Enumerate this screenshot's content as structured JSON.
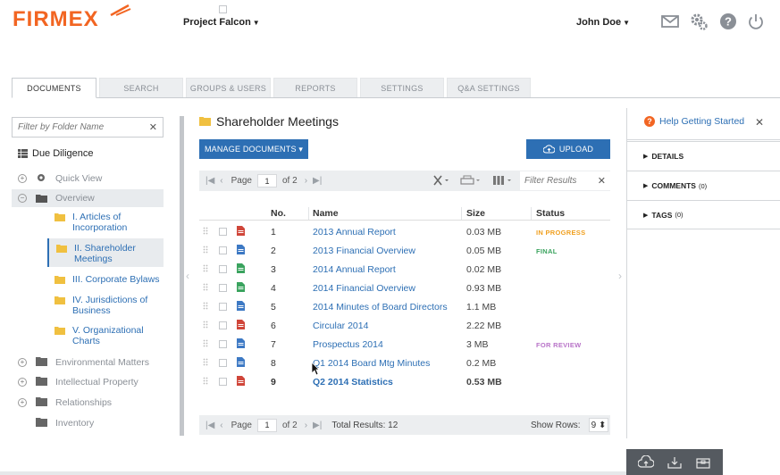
{
  "header": {
    "logo": "FIRMEX",
    "project": "Project Falcon",
    "user": "John Doe",
    "icons": [
      "mail-icon",
      "gears-icon",
      "help-icon",
      "power-icon"
    ]
  },
  "tabs": [
    {
      "label": "DOCUMENTS",
      "active": true
    },
    {
      "label": "SEARCH"
    },
    {
      "label": "GROUPS & USERS"
    },
    {
      "label": "REPORTS"
    },
    {
      "label": "SETTINGS"
    },
    {
      "label": "Q&A SETTINGS"
    }
  ],
  "tree": {
    "filter_placeholder": "Filter by Folder Name",
    "root": "Due Diligence",
    "quick_view": "Quick View",
    "overview": "Overview",
    "subfolders": [
      "I. Articles of Incorporation",
      "II. Shareholder Meetings",
      "III. Corporate Bylaws",
      "IV. Jurisdictions of Business",
      "V. Organizational Charts"
    ],
    "others": [
      "Environmental Matters",
      "Intellectual Property",
      "Relationships",
      "Inventory"
    ]
  },
  "center": {
    "folder_title": "Shareholder Meetings",
    "manage_btn": "MANAGE DOCUMENTS ▾",
    "upload_btn": "UPLOAD",
    "page_label": "Page",
    "page_num": "1",
    "of_pages": "of 2",
    "filter_placeholder": "Filter Results",
    "headers": {
      "no": "No.",
      "name": "Name",
      "size": "Size",
      "status": "Status"
    },
    "rows": [
      {
        "no": "1",
        "name": "2013 Annual Report",
        "size": "0.03 MB",
        "status": "IN PROGRESS",
        "file": "pdf"
      },
      {
        "no": "2",
        "name": "2013 Financial Overview",
        "size": "0.05 MB",
        "status": "FINAL",
        "file": "doc"
      },
      {
        "no": "3",
        "name": "2014 Annual Report",
        "size": "0.02 MB",
        "status": "",
        "file": "xls"
      },
      {
        "no": "4",
        "name": "2014 Financial Overview",
        "size": "0.93 MB",
        "status": "",
        "file": "xls"
      },
      {
        "no": "5",
        "name": "2014 Minutes of Board Directors",
        "size": "1.1 MB",
        "status": "",
        "file": "doc"
      },
      {
        "no": "6",
        "name": "Circular 2014",
        "size": "2.22 MB",
        "status": "",
        "file": "pdf"
      },
      {
        "no": "7",
        "name": "Prospectus 2014",
        "size": "3 MB",
        "status": "FOR REVIEW",
        "file": "doc"
      },
      {
        "no": "8",
        "name": "Q1 2014 Board Mtg Minutes",
        "size": "0.2 MB",
        "status": "",
        "file": "doc"
      },
      {
        "no": "9",
        "name": "Q2 2014 Statistics",
        "size": "0.53 MB",
        "status": "",
        "file": "pdf",
        "bold": true
      }
    ],
    "total_results": "Total Results: 12",
    "show_rows": "Show Rows:",
    "rows_value": "9 ⬍"
  },
  "right": {
    "help": "Help Getting Started",
    "details": "DETAILS",
    "comments": "COMMENTS",
    "comments_count": "(0)",
    "tags": "TAGS",
    "tags_count": "(0)"
  },
  "colors": {
    "brand": "#f26522",
    "link": "#2d6fb4",
    "in_progress": "#f0a020",
    "final": "#3aa35e",
    "for_review": "#b873c8"
  }
}
